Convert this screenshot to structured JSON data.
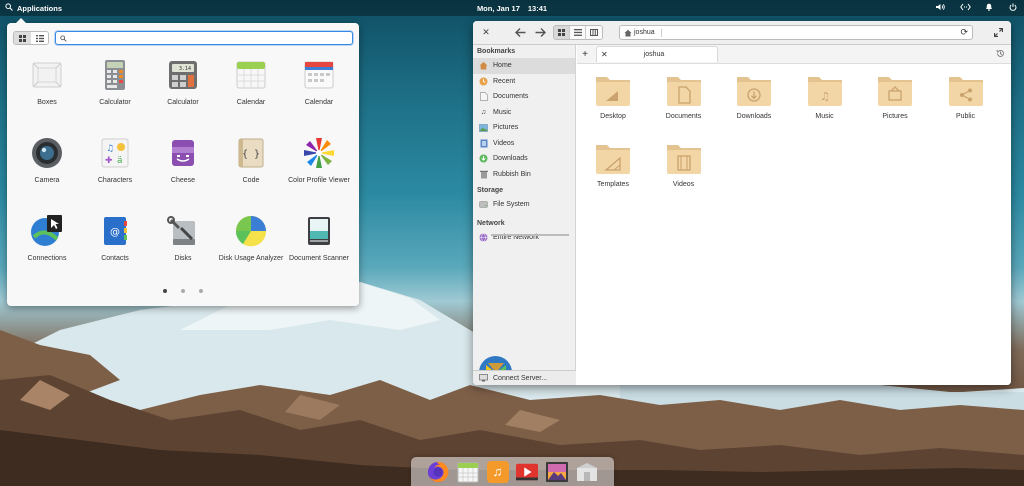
{
  "panel": {
    "applications_label": "Applications",
    "date": "Mon, Jan 17",
    "time": "13:41",
    "tray_icons": [
      "volume-icon",
      "network-icon",
      "notifications-icon",
      "power-icon"
    ]
  },
  "launcher": {
    "search_value": "",
    "view_modes": [
      "grid",
      "category"
    ],
    "apps": [
      {
        "name": "Boxes",
        "icon": "boxes-icon"
      },
      {
        "name": "Calculator",
        "icon": "calculator-icon"
      },
      {
        "name": "Calculator",
        "icon": "calculator-icon"
      },
      {
        "name": "Calendar",
        "icon": "calendar-icon"
      },
      {
        "name": "Calendar",
        "icon": "calendar-icon"
      },
      {
        "name": "Camera",
        "icon": "camera-icon"
      },
      {
        "name": "Characters",
        "icon": "characters-icon"
      },
      {
        "name": "Cheese",
        "icon": "cheese-icon"
      },
      {
        "name": "Code",
        "icon": "code-icon"
      },
      {
        "name": "Color Profile Viewer",
        "icon": "color-profile-icon"
      },
      {
        "name": "Connections",
        "icon": "connections-icon"
      },
      {
        "name": "Contacts",
        "icon": "contacts-icon"
      },
      {
        "name": "Disks",
        "icon": "disks-icon"
      },
      {
        "name": "Disk Usage Analyzer",
        "icon": "disk-usage-icon"
      },
      {
        "name": "Document Scanner",
        "icon": "scanner-icon"
      }
    ],
    "pages": 3,
    "current_page": 1
  },
  "files": {
    "path": "joshua",
    "tab_label": "joshua",
    "sidebar": {
      "bookmarks_header": "Bookmarks",
      "bookmarks": [
        {
          "label": "Home",
          "icon": "home-icon",
          "active": true
        },
        {
          "label": "Recent",
          "icon": "recent-icon"
        },
        {
          "label": "Documents",
          "icon": "documents-icon"
        },
        {
          "label": "Music",
          "icon": "music-icon"
        },
        {
          "label": "Pictures",
          "icon": "pictures-icon"
        },
        {
          "label": "Videos",
          "icon": "videos-icon"
        },
        {
          "label": "Downloads",
          "icon": "downloads-icon"
        },
        {
          "label": "Rubbish Bin",
          "icon": "trash-icon"
        }
      ],
      "storage_header": "Storage",
      "storage": [
        {
          "label": "File System",
          "icon": "drive-icon"
        }
      ],
      "network_header": "Network",
      "network": [
        {
          "label": "Entire Network",
          "icon": "network-icon"
        }
      ],
      "connect_label": "Connect Server..."
    },
    "folders": [
      {
        "label": "Desktop",
        "icon": "desktop-folder-icon"
      },
      {
        "label": "Documents",
        "icon": "documents-folder-icon"
      },
      {
        "label": "Downloads",
        "icon": "downloads-folder-icon"
      },
      {
        "label": "Music",
        "icon": "music-folder-icon"
      },
      {
        "label": "Pictures",
        "icon": "pictures-folder-icon"
      },
      {
        "label": "Public",
        "icon": "public-folder-icon"
      },
      {
        "label": "Templates",
        "icon": "templates-folder-icon"
      },
      {
        "label": "Videos",
        "icon": "videos-folder-icon"
      }
    ]
  },
  "dock": [
    {
      "icon": "firefox-icon"
    },
    {
      "icon": "calendar-icon"
    },
    {
      "icon": "music-icon"
    },
    {
      "icon": "videos-icon"
    },
    {
      "icon": "photos-icon"
    },
    {
      "icon": "appcenter-icon"
    }
  ]
}
